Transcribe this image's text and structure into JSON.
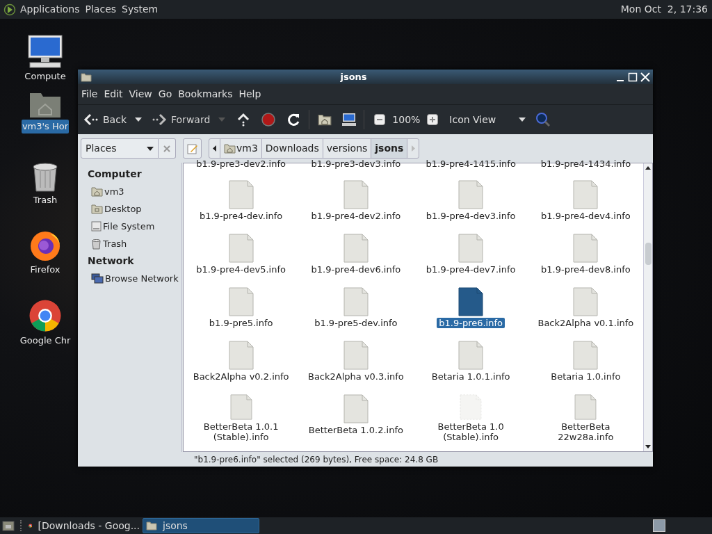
{
  "top_panel": {
    "menus": [
      "Applications",
      "Places",
      "System"
    ],
    "clock": "Mon Oct  2, 17:36"
  },
  "desktop_icons": [
    {
      "label": "Compute",
      "kind": "computer",
      "selected": false
    },
    {
      "label": "vm3's Hor",
      "kind": "home",
      "selected": true
    },
    {
      "label": "Trash",
      "kind": "trash",
      "selected": false
    },
    {
      "label": "Firefox",
      "kind": "firefox",
      "selected": false
    },
    {
      "label": "Google Chr",
      "kind": "chrome",
      "selected": false
    }
  ],
  "window": {
    "title": "jsons",
    "menu": [
      "File",
      "Edit",
      "View",
      "Go",
      "Bookmarks",
      "Help"
    ],
    "toolbar": {
      "back": "Back",
      "forward": "Forward",
      "zoom": "100%",
      "view": "Icon View"
    },
    "location": {
      "places": "Places",
      "crumbs": [
        {
          "label": "vm3",
          "kind": "home",
          "selected": false
        },
        {
          "label": "Downloads",
          "kind": "folder",
          "selected": false
        },
        {
          "label": "versions",
          "kind": "folder",
          "selected": false
        },
        {
          "label": "jsons",
          "kind": "folder",
          "selected": true
        }
      ]
    },
    "sidebar": [
      {
        "heading": "Computer",
        "items": [
          {
            "label": "vm3",
            "kind": "home"
          },
          {
            "label": "Desktop",
            "kind": "desktop"
          },
          {
            "label": "File System",
            "kind": "drive"
          },
          {
            "label": "Trash",
            "kind": "trash"
          }
        ]
      },
      {
        "heading": "Network",
        "items": [
          {
            "label": "Browse Network",
            "kind": "network"
          }
        ]
      }
    ],
    "partial_row": [
      "b1.9-pre3-dev2.info",
      "b1.9-pre3-dev3.info",
      "b1.9-pre4-1415.info",
      "b1.9-pre4-1434.info"
    ],
    "files": [
      {
        "name": "b1.9-pre4-dev.info",
        "selected": false,
        "dimmed": false
      },
      {
        "name": "b1.9-pre4-dev2.info",
        "selected": false,
        "dimmed": false
      },
      {
        "name": "b1.9-pre4-dev3.info",
        "selected": false,
        "dimmed": false
      },
      {
        "name": "b1.9-pre4-dev4.info",
        "selected": false,
        "dimmed": false
      },
      {
        "name": "b1.9-pre4-dev5.info",
        "selected": false,
        "dimmed": false
      },
      {
        "name": "b1.9-pre4-dev6.info",
        "selected": false,
        "dimmed": false
      },
      {
        "name": "b1.9-pre4-dev7.info",
        "selected": false,
        "dimmed": false
      },
      {
        "name": "b1.9-pre4-dev8.info",
        "selected": false,
        "dimmed": false
      },
      {
        "name": "b1.9-pre5.info",
        "selected": false,
        "dimmed": false
      },
      {
        "name": "b1.9-pre5-dev.info",
        "selected": false,
        "dimmed": false
      },
      {
        "name": "b1.9-pre6.info",
        "selected": true,
        "dimmed": false
      },
      {
        "name": "Back2Alpha v0.1.info",
        "selected": false,
        "dimmed": false
      },
      {
        "name": "Back2Alpha v0.2.info",
        "selected": false,
        "dimmed": false
      },
      {
        "name": "Back2Alpha v0.3.info",
        "selected": false,
        "dimmed": false
      },
      {
        "name": "Betaria 1.0.1.info",
        "selected": false,
        "dimmed": false
      },
      {
        "name": "Betaria 1.0.info",
        "selected": false,
        "dimmed": false
      },
      {
        "name": "BetterBeta 1.0.1 (Stable).info",
        "selected": false,
        "dimmed": false
      },
      {
        "name": "BetterBeta 1.0.2.info",
        "selected": false,
        "dimmed": false
      },
      {
        "name": "BetterBeta 1.0 (Stable).info",
        "selected": false,
        "dimmed": true
      },
      {
        "name": "BetterBeta 22w28a.info",
        "selected": false,
        "dimmed": false
      }
    ],
    "status": "\"b1.9-pre6.info\" selected (269 bytes), Free space: 24.8 GB"
  },
  "taskbar": {
    "tasks": [
      {
        "label": "[Downloads - Goog...",
        "kind": "chrome",
        "selected": false
      },
      {
        "label": "jsons",
        "kind": "folder",
        "selected": true
      }
    ]
  }
}
